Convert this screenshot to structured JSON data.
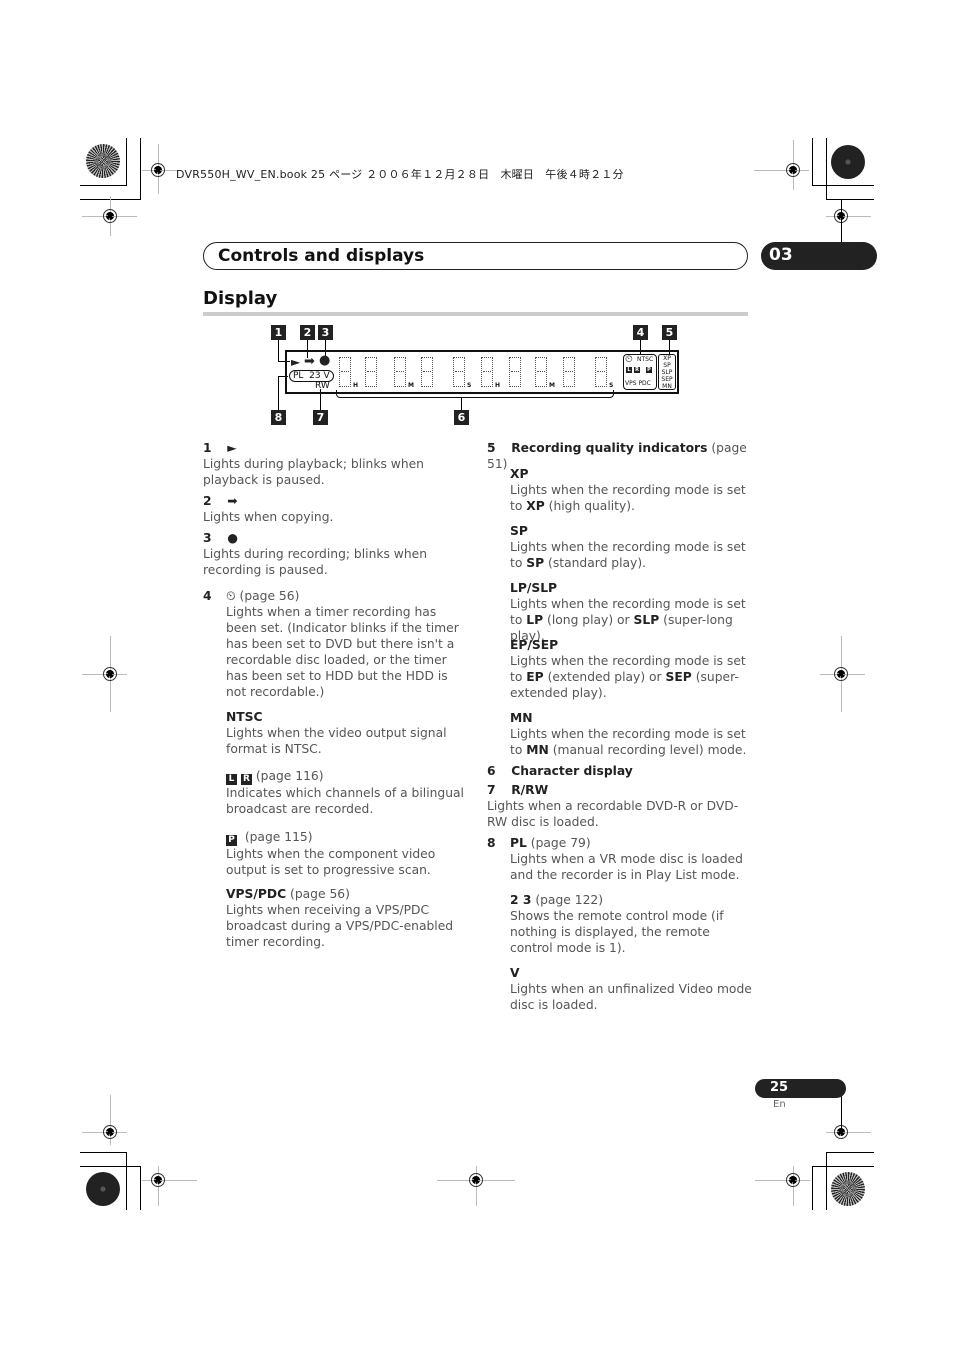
{
  "print_header": "DVR550H_WV_EN.book  25 ページ  ２００６年１２月２８日　木曜日　午後４時２１分",
  "chapter": {
    "title": "Controls and displays",
    "number": "03"
  },
  "section": {
    "title": "Display"
  },
  "diagram": {
    "callouts": [
      "1",
      "2",
      "3",
      "4",
      "5",
      "6",
      "7",
      "8"
    ],
    "panel_text": {
      "pl_box": "PL  23 V",
      "rw": "RW",
      "time_units": [
        "H",
        "M",
        "S",
        "H",
        "M",
        "S"
      ],
      "ntsc": "NTSC",
      "lr_p": [
        "L",
        "R",
        "P"
      ],
      "vps_pdc": "VPS PDC",
      "quality": [
        "XP",
        "SP",
        "SLP",
        "SEP",
        "MN"
      ]
    }
  },
  "left_column": [
    {
      "num": "1",
      "glyph": "►",
      "desc": "Lights during playback; blinks when playback is paused."
    },
    {
      "num": "2",
      "glyph": "➡",
      "desc": "Lights when copying."
    },
    {
      "num": "3",
      "glyph": "●",
      "desc": "Lights during recording; blinks when recording is paused."
    },
    {
      "num": "4",
      "glyph": "⏲",
      "page": "(page 56)",
      "desc": "Lights when a timer recording has been set. (Indicator blinks if the timer has been set to DVD but there isn't a recordable disc loaded, or the timer has been set to HDD but the HDD is not recordable.)"
    }
  ],
  "left_sub": [
    {
      "title": "NTSC",
      "desc": "Lights when the video output signal format is NTSC."
    },
    {
      "icons": [
        "L",
        "R"
      ],
      "page": "(page 116)",
      "desc": "Indicates which channels of a bilingual broadcast are recorded."
    },
    {
      "icons": [
        "P"
      ],
      "page": "(page 115)",
      "desc": "Lights when the component video output is set to progressive scan."
    },
    {
      "title": "VPS/PDC",
      "page": "(page 56)",
      "desc": "Lights when receiving a VPS/PDC broadcast during a VPS/PDC-enabled timer recording."
    }
  ],
  "right_column": {
    "item5": {
      "num": "5",
      "title": "Recording quality indicators",
      "page": "(page 51)"
    },
    "modes": [
      {
        "title": "XP",
        "pre": "Lights when the recording mode is set to ",
        "b1": "XP",
        "post": " (high quality)."
      },
      {
        "title": "SP",
        "pre": "Lights when the recording mode is set to ",
        "b1": "SP",
        "post": " (standard play)."
      },
      {
        "title": "LP/SLP",
        "pre": "Lights when the recording mode is set to ",
        "b1": "LP",
        "mid": " (long play) or ",
        "b2": "SLP",
        "post": " (super-long play)."
      },
      {
        "title": "EP/SEP",
        "pre": "Lights when the recording mode is set to ",
        "b1": "EP",
        "mid": " (extended play) or ",
        "b2": "SEP",
        "post": " (super-extended play)."
      },
      {
        "title": "MN",
        "pre": "Lights when the recording mode is set to ",
        "b1": "MN",
        "post": " (manual recording level) mode."
      }
    ],
    "item6": {
      "num": "6",
      "title": "Character display"
    },
    "item7": {
      "num": "7",
      "title": "R/RW",
      "desc": "Lights when a recordable DVD-R or DVD-RW disc is loaded."
    },
    "item8": {
      "num": "8",
      "title": "PL",
      "page": "(page 79)",
      "desc": "Lights when a VR mode disc is loaded and the recorder is in Play List mode."
    },
    "sub23": {
      "title": "2 3",
      "page": "(page 122)",
      "desc": "Shows the remote control mode (if nothing is displayed, the remote control mode is 1)."
    },
    "subV": {
      "title": "V",
      "desc": "Lights when an unfinalized Video mode disc is loaded."
    }
  },
  "footer": {
    "page": "25",
    "lang": "En"
  }
}
